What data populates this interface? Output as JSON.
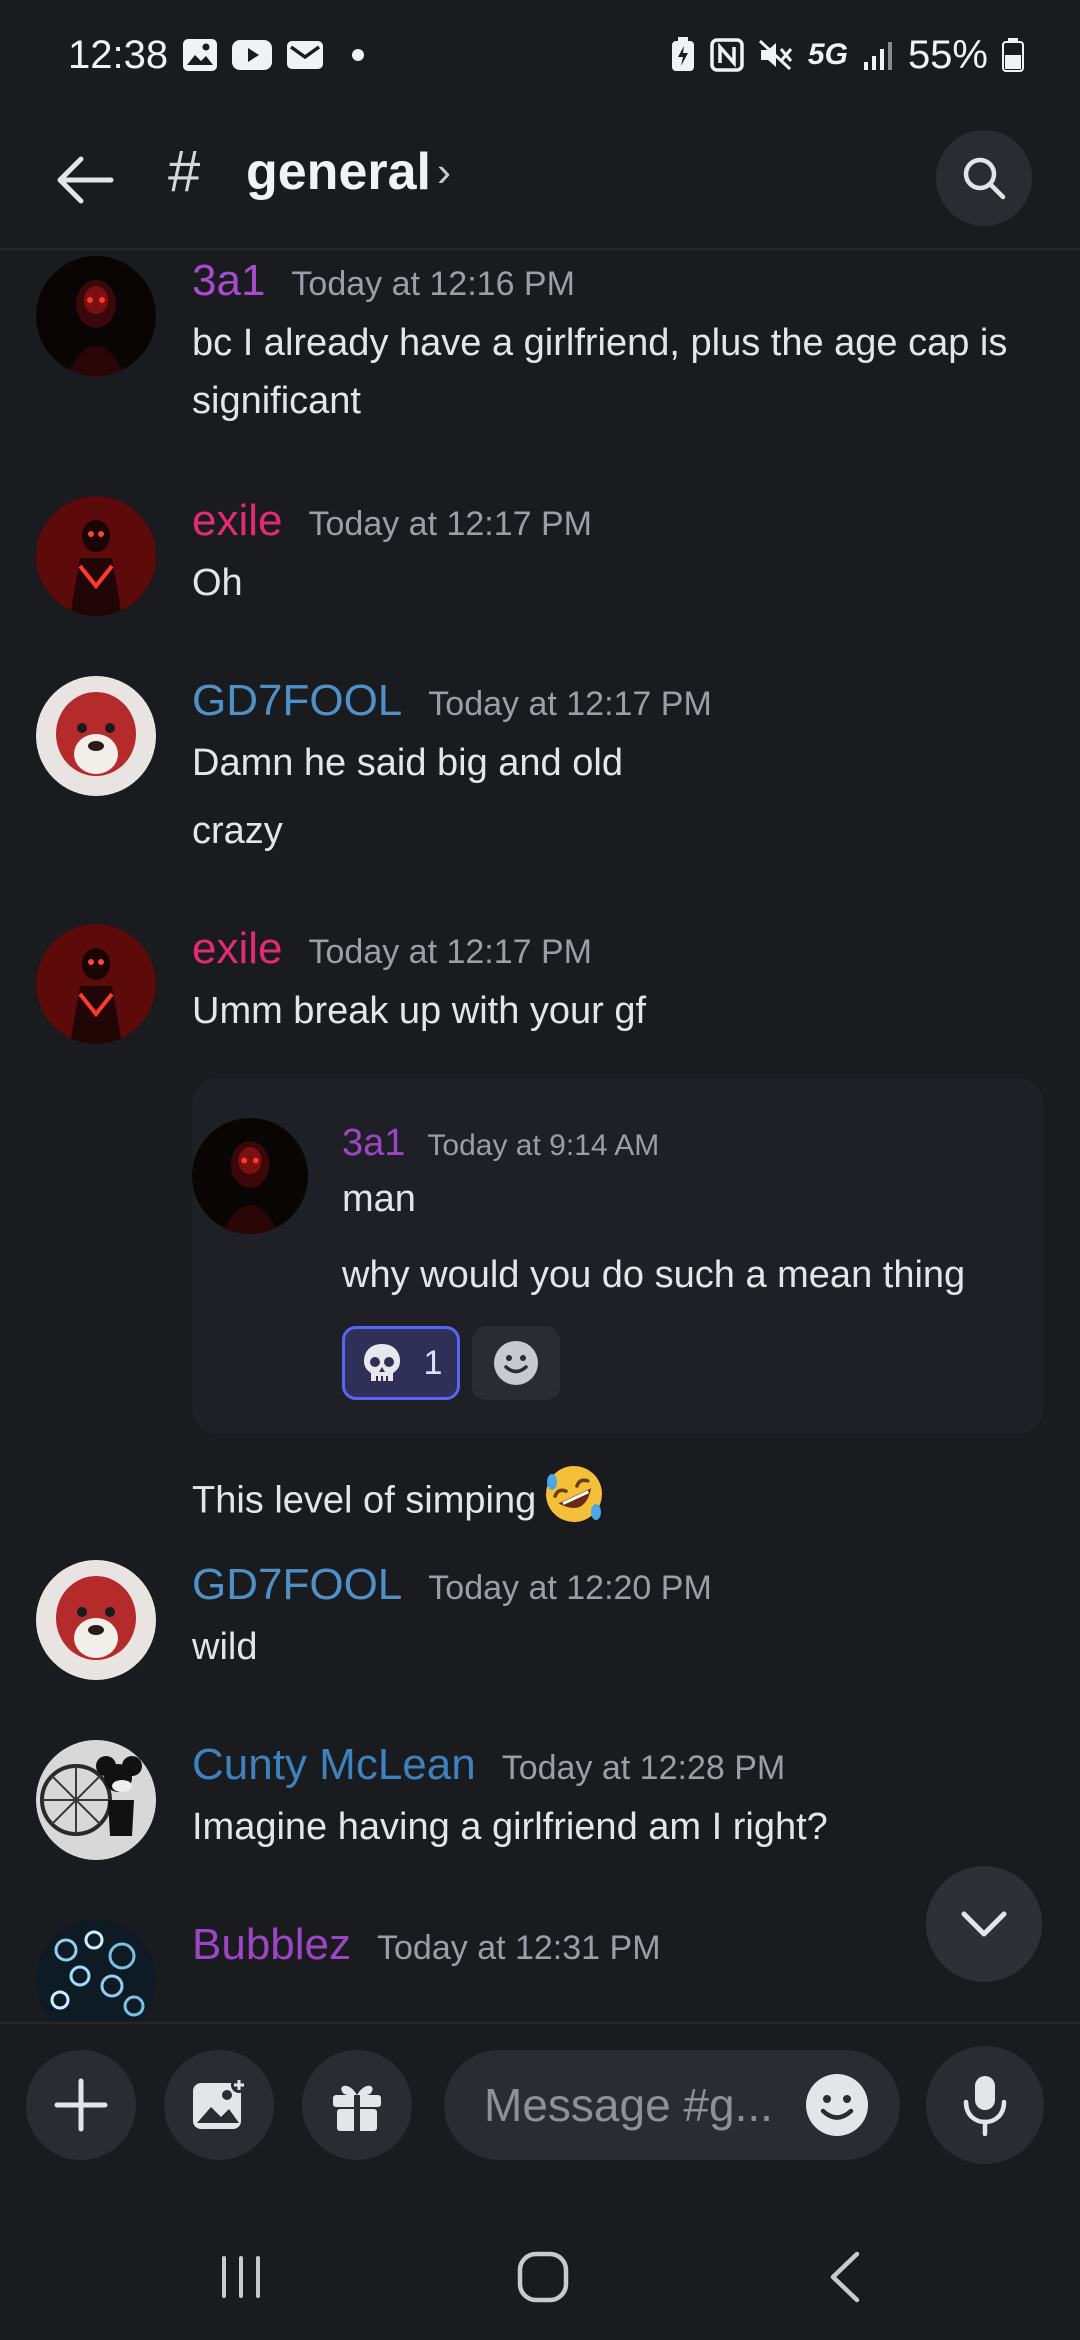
{
  "status_bar": {
    "time": "12:38",
    "network": "5G",
    "battery": "55%",
    "icons": [
      "gallery-icon",
      "youtube-icon",
      "mail-icon",
      "battery-saver-icon",
      "nfc-icon",
      "mute-icon",
      "signal-icon",
      "battery-icon"
    ]
  },
  "header": {
    "hash": "#",
    "channel": "general",
    "chevron": "›"
  },
  "messages": [
    {
      "author": "3a1",
      "author_color": "#a74bcf",
      "time": "Today at 12:16 PM",
      "lines": [
        "bc I already have a girlfriend, plus the age cap is significant"
      ]
    },
    {
      "author": "exile",
      "author_color": "#e32b72",
      "time": "Today at 12:17 PM",
      "lines": [
        "Oh"
      ]
    },
    {
      "author": "GD7FOOL",
      "author_color": "#4f91c6",
      "time": "Today at 12:17 PM",
      "lines": [
        "Damn he said big and old",
        "crazy"
      ]
    },
    {
      "author": "exile",
      "author_color": "#e32b72",
      "time": "Today at 12:17 PM",
      "lines": [
        "Umm break up with your gf"
      ],
      "quote": {
        "author": "3a1",
        "time": "Today at 9:14 AM",
        "lines": [
          "man",
          "why would you do such a mean thing"
        ],
        "reaction": {
          "emoji": "skull-icon",
          "count": "1"
        }
      },
      "after": "This level of simping"
    },
    {
      "author": "GD7FOOL",
      "author_color": "#4f91c6",
      "time": "Today at 12:20 PM",
      "lines": [
        "wild"
      ]
    },
    {
      "author": "Cunty McLean",
      "author_color": "#3d82bf",
      "time": "Today at 12:28 PM",
      "lines": [
        "Imagine having a girlfriend am I right?"
      ]
    },
    {
      "author": "Bubblez",
      "author_color": "#9d46c5",
      "time": "Today at 12:31 PM",
      "lines": []
    }
  ],
  "composer": {
    "placeholder": "Message #g..."
  }
}
